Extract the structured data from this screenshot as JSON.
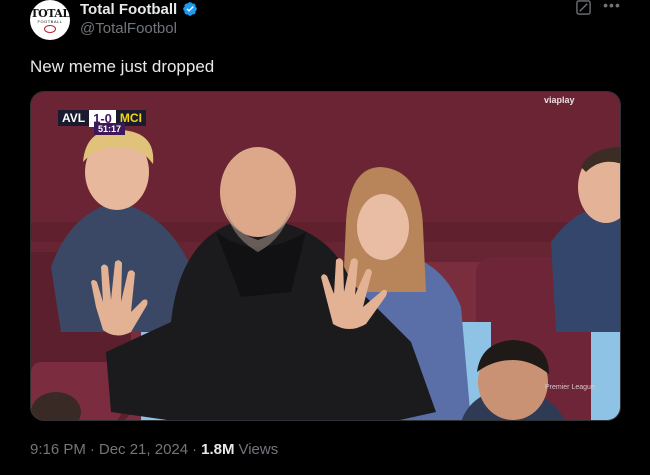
{
  "account": {
    "display_name": "Total Football",
    "handle": "@TotalFootbol",
    "avatar_logo_text": "TOTAL",
    "avatar_logo_sub": "FOOTBALL",
    "verified": true,
    "verified_color": "#1d9bf0"
  },
  "tweet": {
    "text": "New meme just dropped"
  },
  "media": {
    "scoreboard": {
      "home_team": "AVL",
      "away_team": "MCI",
      "score": "1-0",
      "clock": "51:17"
    },
    "broadcaster": "viaplay",
    "watermark": "Premier League"
  },
  "footer": {
    "time": "9:16 PM",
    "separator": "·",
    "date": "Dec 21, 2024",
    "views_count": "1.8M",
    "views_label": "Views"
  },
  "icons": {
    "grok": "grok-icon",
    "more": "more-icon",
    "verified": "verified-badge-icon"
  },
  "colors": {
    "background": "#000000",
    "primary_text": "#e7e9ea",
    "secondary_text": "#71767b",
    "accent": "#1d9bf0"
  }
}
